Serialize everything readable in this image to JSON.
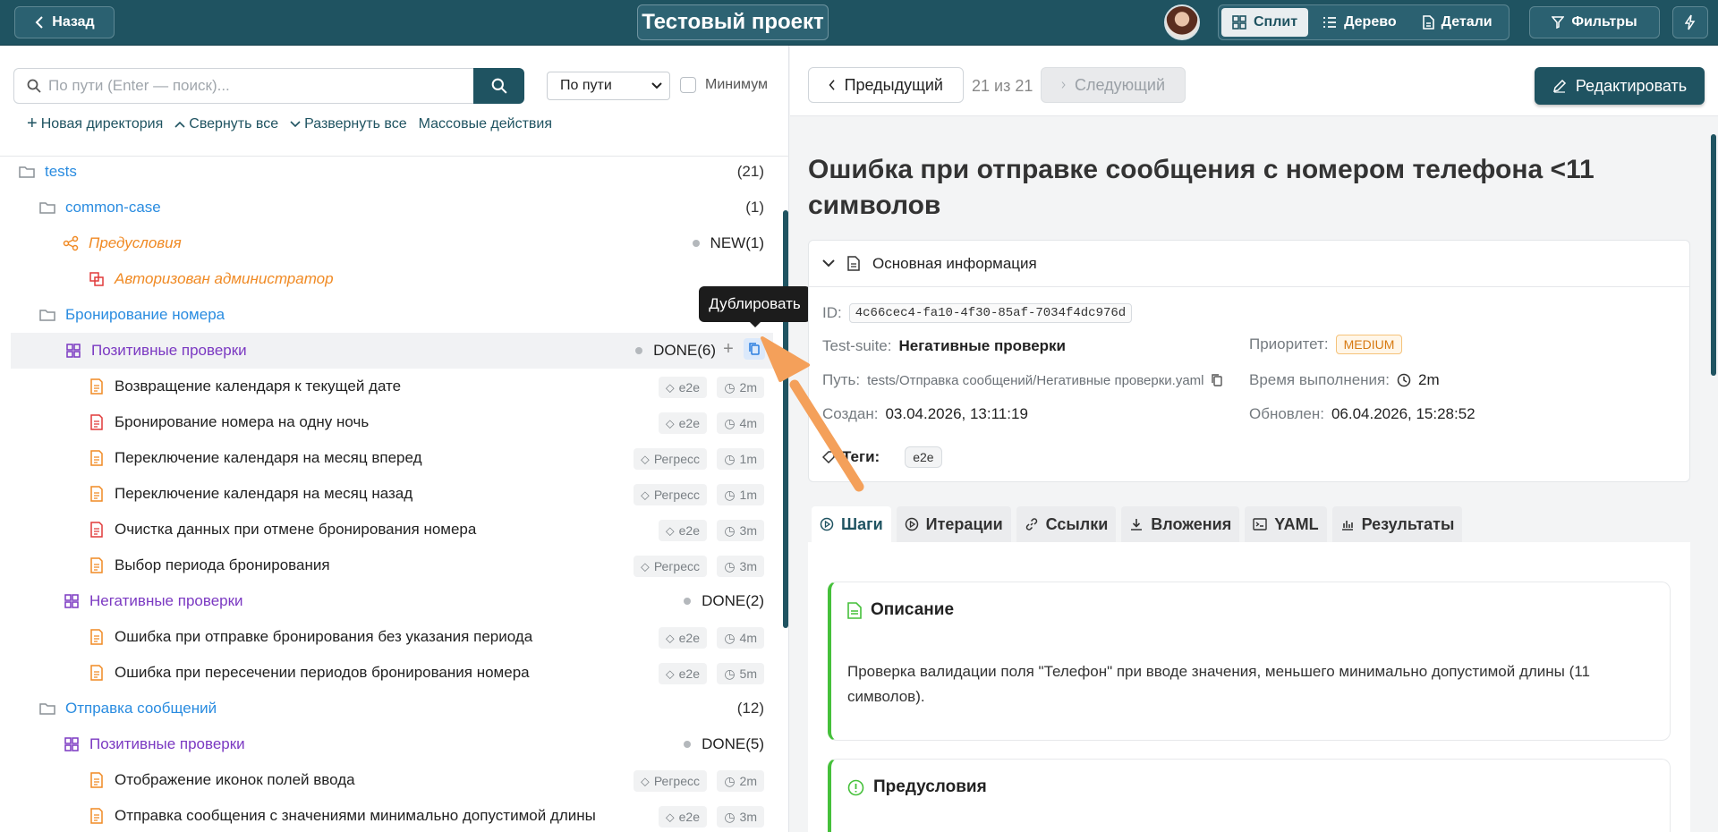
{
  "header": {
    "back_label": "Назад",
    "project_title": "Тестовый проект",
    "views": [
      {
        "label": "Сплит",
        "icon": "split-view-icon",
        "active": true
      },
      {
        "label": "Дерево",
        "icon": "list-icon",
        "active": false
      },
      {
        "label": "Детали",
        "icon": "document-icon",
        "active": false
      }
    ],
    "filters_label": "Фильтры"
  },
  "sidebar": {
    "search_placeholder": "По пути (Enter — поиск)...",
    "mode_select": "По пути",
    "minimum_label": "Минимум",
    "actions": [
      "Новая директория",
      "Свернуть все",
      "Развернуть все",
      "Массовые действия"
    ],
    "tree": [
      {
        "label": "tests",
        "count": "(21)"
      },
      {
        "label": "common-case",
        "count": "(1)"
      },
      {
        "label": "Предусловия",
        "status": "NEW(1)"
      },
      {
        "label": "Авторизован администратор"
      },
      {
        "label": "Бронирование номера"
      },
      {
        "label": "Позитивные проверки",
        "status": "DONE(6)"
      },
      {
        "label": "Возвращение календаря к текущей дате",
        "tag": "e2e",
        "time": "2m"
      },
      {
        "label": "Бронирование номера на одну ночь",
        "tag": "e2e",
        "time": "4m"
      },
      {
        "label": "Переключение календаря на месяц вперед",
        "tag": "Регресс",
        "time": "1m"
      },
      {
        "label": "Переключение календаря на месяц назад",
        "tag": "Регресс",
        "time": "1m"
      },
      {
        "label": "Очистка данных при отмене бронирования номера",
        "tag": "e2e",
        "time": "3m"
      },
      {
        "label": "Выбор периода бронирования",
        "tag": "Регресс",
        "time": "3m"
      },
      {
        "label": "Негативные проверки",
        "status": "DONE(2)"
      },
      {
        "label": "Ошибка при отправке бронирования без указания периода",
        "tag": "e2e",
        "time": "4m"
      },
      {
        "label": "Ошибка при пересечении периодов бронирования номера",
        "tag": "e2e",
        "time": "5m"
      },
      {
        "label": "Отправка сообщений",
        "count": "(12)"
      },
      {
        "label": "Позитивные проверки",
        "status": "DONE(5)"
      },
      {
        "label": "Отображение иконок полей ввода",
        "tag": "Регресс",
        "time": "2m"
      },
      {
        "label": "Отправка сообщения с значениями минимально допустимой длины",
        "tag": "e2e",
        "time": "3m"
      }
    ],
    "tooltip": "Дублировать"
  },
  "detail": {
    "prev_label": "Предыдущий",
    "position": "21 из 21",
    "next_label": "Следующий",
    "edit_label": "Редактировать",
    "title": "Ошибка при отправке сообщения с номером телефона <11 символов",
    "info_header": "Основная информация",
    "id_label": "ID:",
    "id_value": "4c66cec4-fa10-4f30-85af-7034f4dc976d",
    "suite_label": "Test-suite:",
    "suite_value": "Негативные проверки",
    "path_label": "Путь:",
    "path_value": "tests/Отправка сообщений/Негативные проверки.yaml",
    "created_label": "Создан:",
    "created_value": "03.04.2026, 13:11:19",
    "priority_label": "Приоритет:",
    "priority_value": "MEDIUM",
    "duration_label": "Время выполнения:",
    "duration_value": "2m",
    "updated_label": "Обновлен:",
    "updated_value": "06.04.2026, 15:28:52",
    "tags_label": "Теги:",
    "tag_value": "e2e",
    "tabs": [
      "Шаги",
      "Итерации",
      "Ссылки",
      "Вложения",
      "YAML",
      "Результаты"
    ],
    "description_title": "Описание",
    "description_text": "Проверка валидации поля \"Телефон\" при вводе значения, меньшего минимально допустимой длины (11 символов).",
    "preconditions_title": "Предусловия"
  },
  "colors": {
    "brand": "#1f5361",
    "folder": "#2a8ce0",
    "suite": "#7b39c2",
    "precondition": "#f08a24",
    "section_accent": "#45c03a",
    "arrow": "#f4a05a"
  }
}
